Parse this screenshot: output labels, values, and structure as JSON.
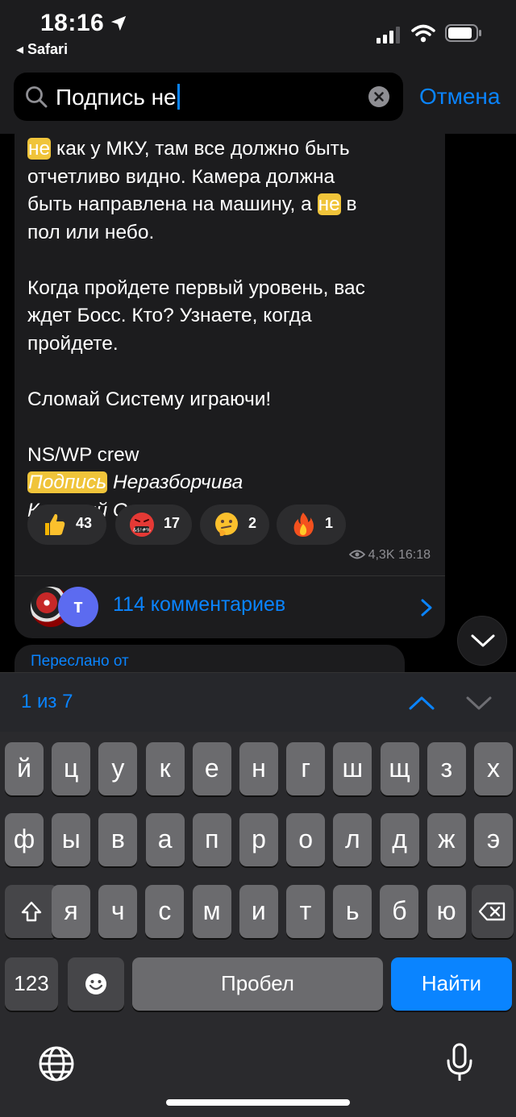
{
  "status_bar": {
    "time": "18:16",
    "back_app": "◂ Safari",
    "icons": [
      "location-arrow-icon",
      "signal-icon",
      "wifi-icon",
      "battery-icon"
    ]
  },
  "search": {
    "query": "Подпись не",
    "cancel_label": "Отмена",
    "icons": [
      "search-icon",
      "clear-icon"
    ]
  },
  "message": {
    "line1_highlight": "не",
    "line1_rest": " как у МКУ, там все должно быть",
    "line2": "отчетливо видно. Камера должна",
    "line3_before": "быть направлена на машину, а ",
    "line3_highlight": "не",
    "line3_after": " в",
    "line4": "пол или небо.",
    "para2_line1": "Когда пройдете первый уровень, вас",
    "para2_line2": "ждет Босс. Кто? Узнаете, когда",
    "para2_line3": "пройдете.",
    "para3": "Сломай Систему играючи!",
    "sig_crew": "NS/WP crew",
    "sig_highlight": "Подпись",
    "sig_rest": " Неразборчива",
    "sig_name": "Красный Смех"
  },
  "reactions": [
    {
      "emoji": "thumbs-up-icon",
      "count": "43"
    },
    {
      "emoji": "cursing-face-icon",
      "count": "17"
    },
    {
      "emoji": "thinking-face-icon",
      "count": "2"
    },
    {
      "emoji": "fire-icon",
      "count": "1"
    }
  ],
  "meta": {
    "views": "4,3K",
    "time": "16:18"
  },
  "comments": {
    "avatar_letter": "т",
    "label": "114 комментариев"
  },
  "next_message": {
    "forwarded_label": "Переслано от"
  },
  "find_bar": {
    "count": "1 из 7"
  },
  "keyboard": {
    "row1": [
      "й",
      "ц",
      "у",
      "к",
      "е",
      "н",
      "г",
      "ш",
      "щ",
      "з",
      "х"
    ],
    "row2": [
      "ф",
      "ы",
      "в",
      "а",
      "п",
      "р",
      "о",
      "л",
      "д",
      "ж",
      "э"
    ],
    "row3": [
      "я",
      "ч",
      "с",
      "м",
      "и",
      "т",
      "ь",
      "б",
      "ю"
    ],
    "numbers_label": "123",
    "space_label": "Пробел",
    "action_label": "Найти"
  },
  "colors": {
    "accent": "#0a84ff",
    "highlight": "#f0c43a",
    "bubble": "#1c1c1e"
  }
}
